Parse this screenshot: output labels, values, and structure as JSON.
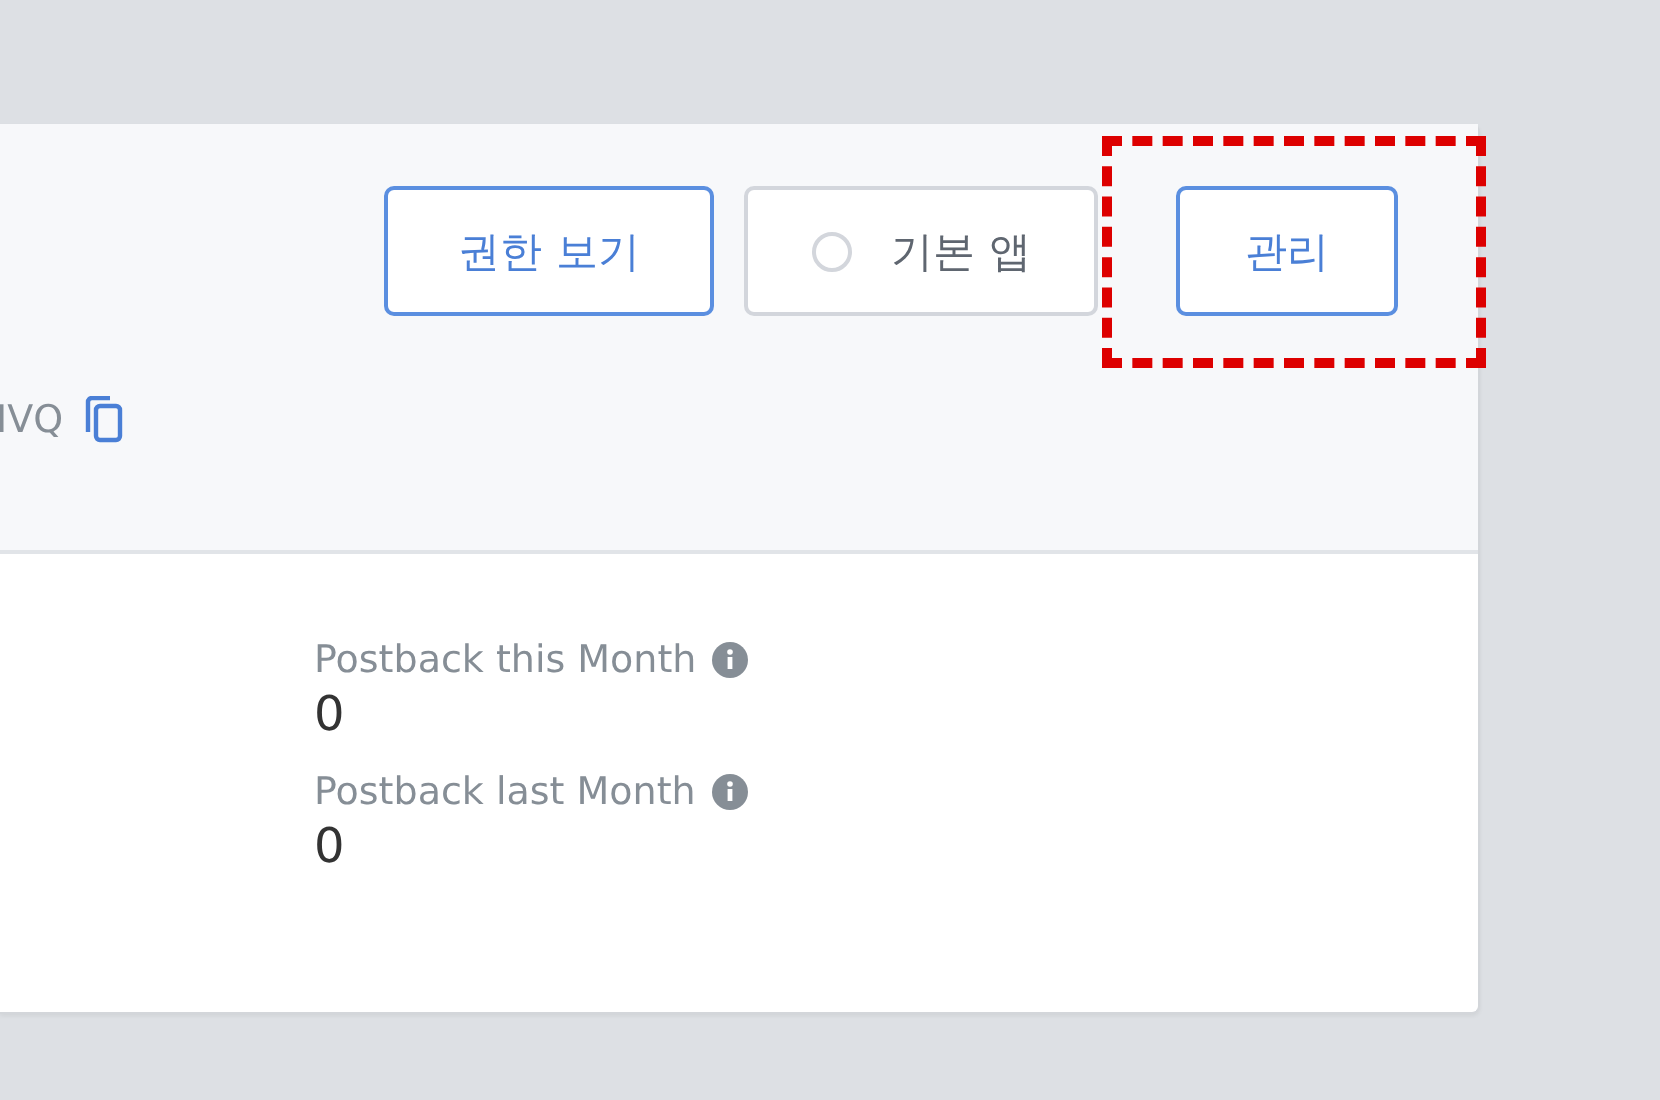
{
  "header": {
    "buttons": [
      {
        "kind": "outline",
        "label": "권한 보기",
        "highlighted": false
      },
      {
        "kind": "radio",
        "label": "기본 앱",
        "selected": false,
        "highlighted": false
      },
      {
        "kind": "outline",
        "label": "관리",
        "highlighted": true
      }
    ],
    "id_text": "IVQ"
  },
  "stats": [
    {
      "label": "Postback this Month",
      "value": "0"
    },
    {
      "label": "Postback last Month",
      "value": "0"
    }
  ]
}
